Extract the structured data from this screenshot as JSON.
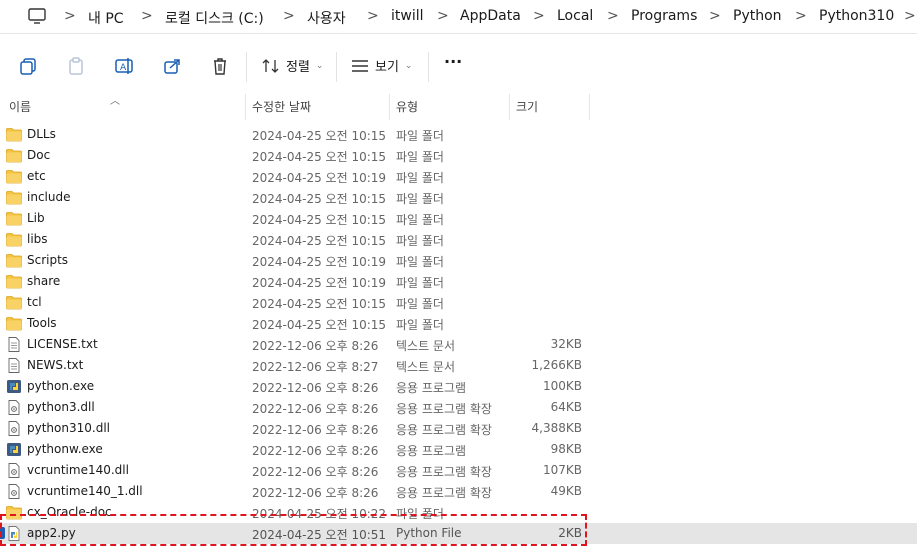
{
  "breadcrumb": [
    "내 PC",
    "로컬 디스크 (C:)",
    "사용자",
    "itwill",
    "AppData",
    "Local",
    "Programs",
    "Python",
    "Python310"
  ],
  "breadcrumb_separator": ">",
  "toolbar": {
    "sort_label": "정렬",
    "view_label": "보기",
    "more_label": "···"
  },
  "columns": {
    "name": "이름",
    "date": "수정한 날짜",
    "type": "유형",
    "size": "크기"
  },
  "files": [
    {
      "name": "DLLs",
      "date": "2024-04-25 오전 10:15",
      "type": "파일 폴더",
      "size": "",
      "icon": "folder-icon"
    },
    {
      "name": "Doc",
      "date": "2024-04-25 오전 10:15",
      "type": "파일 폴더",
      "size": "",
      "icon": "folder-icon"
    },
    {
      "name": "etc",
      "date": "2024-04-25 오전 10:19",
      "type": "파일 폴더",
      "size": "",
      "icon": "folder-icon"
    },
    {
      "name": "include",
      "date": "2024-04-25 오전 10:15",
      "type": "파일 폴더",
      "size": "",
      "icon": "folder-icon"
    },
    {
      "name": "Lib",
      "date": "2024-04-25 오전 10:15",
      "type": "파일 폴더",
      "size": "",
      "icon": "folder-icon"
    },
    {
      "name": "libs",
      "date": "2024-04-25 오전 10:15",
      "type": "파일 폴더",
      "size": "",
      "icon": "folder-icon"
    },
    {
      "name": "Scripts",
      "date": "2024-04-25 오전 10:19",
      "type": "파일 폴더",
      "size": "",
      "icon": "folder-icon"
    },
    {
      "name": "share",
      "date": "2024-04-25 오전 10:19",
      "type": "파일 폴더",
      "size": "",
      "icon": "folder-icon"
    },
    {
      "name": "tcl",
      "date": "2024-04-25 오전 10:15",
      "type": "파일 폴더",
      "size": "",
      "icon": "folder-icon"
    },
    {
      "name": "Tools",
      "date": "2024-04-25 오전 10:15",
      "type": "파일 폴더",
      "size": "",
      "icon": "folder-icon"
    },
    {
      "name": "LICENSE.txt",
      "date": "2022-12-06 오후 8:26",
      "type": "텍스트 문서",
      "size": "32KB",
      "icon": "text-file-icon"
    },
    {
      "name": "NEWS.txt",
      "date": "2022-12-06 오후 8:27",
      "type": "텍스트 문서",
      "size": "1,266KB",
      "icon": "text-file-icon"
    },
    {
      "name": "python.exe",
      "date": "2022-12-06 오후 8:26",
      "type": "응용 프로그램",
      "size": "100KB",
      "icon": "python-exe-icon"
    },
    {
      "name": "python3.dll",
      "date": "2022-12-06 오후 8:26",
      "type": "응용 프로그램 확장",
      "size": "64KB",
      "icon": "dll-file-icon"
    },
    {
      "name": "python310.dll",
      "date": "2022-12-06 오후 8:26",
      "type": "응용 프로그램 확장",
      "size": "4,388KB",
      "icon": "dll-file-icon"
    },
    {
      "name": "pythonw.exe",
      "date": "2022-12-06 오후 8:26",
      "type": "응용 프로그램",
      "size": "98KB",
      "icon": "python-exe-icon"
    },
    {
      "name": "vcruntime140.dll",
      "date": "2022-12-06 오후 8:26",
      "type": "응용 프로그램 확장",
      "size": "107KB",
      "icon": "dll-file-icon"
    },
    {
      "name": "vcruntime140_1.dll",
      "date": "2022-12-06 오후 8:26",
      "type": "응용 프로그램 확장",
      "size": "49KB",
      "icon": "dll-file-icon"
    },
    {
      "name": "cx_Oracle-doc",
      "date": "2024-04-25 오전 10:22",
      "type": "파일 폴더",
      "size": "",
      "icon": "folder-icon"
    },
    {
      "name": "app2.py",
      "date": "2024-04-25 오전 10:51",
      "type": "Python File",
      "size": "2KB",
      "icon": "python-file-icon",
      "selected": true
    }
  ],
  "colors": {
    "folder": "#f4c542",
    "selection": "#e5e5e5",
    "highlight_border": "#e0141e",
    "accent": "#1a5fb4"
  }
}
